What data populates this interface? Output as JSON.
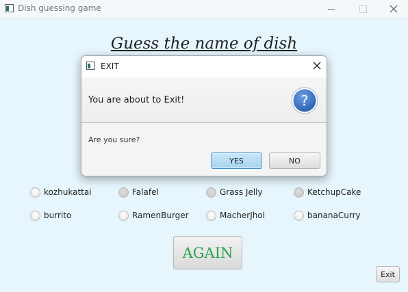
{
  "window": {
    "title": "Dish guessing game",
    "icon": "app-window-icon"
  },
  "main": {
    "heading": "Guess the name of dish",
    "options_row1": [
      "kozhukattai",
      "Falafel",
      "Grass Jelly",
      "KetchupCake"
    ],
    "options_row2": [
      "burrito",
      "RamenBurger",
      "MacherJhol",
      "bananaCurry"
    ],
    "again_label": "AGAIN",
    "exit_label": "Exit"
  },
  "dialog": {
    "title": "EXIT",
    "header_text": "You are about to Exit!",
    "body_text": "Are you sure?",
    "yes_label": "YES",
    "no_label": "NO",
    "icon": "question-icon"
  },
  "colors": {
    "background": "#e6f6fc",
    "again_text": "#2aa34a",
    "question_icon": "#3a73c4",
    "default_button": "#a7d3ef"
  }
}
